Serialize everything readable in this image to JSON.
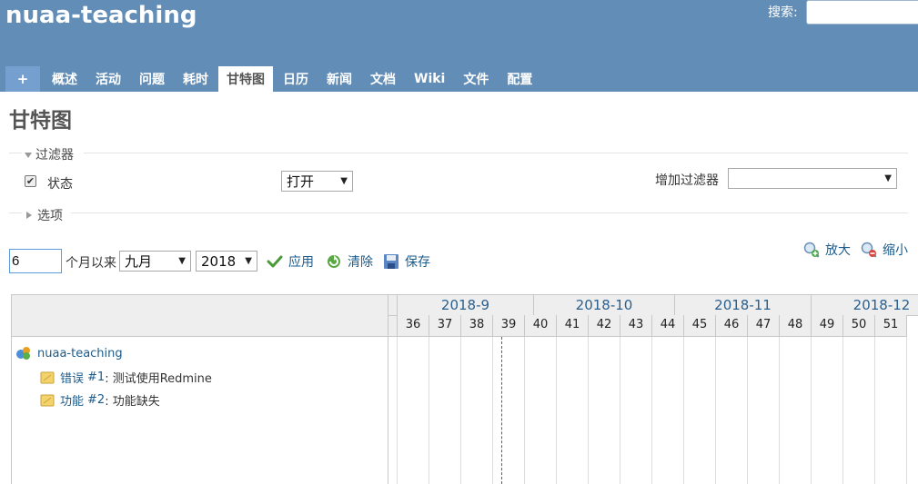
{
  "header": {
    "project_title": "nuaa-teaching",
    "search_label": "搜索:",
    "search_value": ""
  },
  "menu": {
    "new_label": "+",
    "items": [
      {
        "label": "概述",
        "name": "overview"
      },
      {
        "label": "活动",
        "name": "activity"
      },
      {
        "label": "问题",
        "name": "issues"
      },
      {
        "label": "耗时",
        "name": "spent-time"
      },
      {
        "label": "甘特图",
        "name": "gantt",
        "selected": true
      },
      {
        "label": "日历",
        "name": "calendar"
      },
      {
        "label": "新闻",
        "name": "news"
      },
      {
        "label": "文档",
        "name": "documents"
      },
      {
        "label": "Wiki",
        "name": "wiki"
      },
      {
        "label": "文件",
        "name": "files"
      },
      {
        "label": "配置",
        "name": "settings"
      }
    ]
  },
  "page": {
    "heading": "甘特图",
    "filters_legend": "过滤器",
    "status_label": "状态",
    "status_checked": true,
    "status_operator": "打开",
    "add_filter_label": "增加过滤器",
    "add_filter_value": "",
    "options_legend": "选项"
  },
  "controls": {
    "months_value": "6",
    "months_suffix": "个月以来",
    "month_select": "九月",
    "year_select": "2018",
    "apply_label": "应用",
    "clear_label": "清除",
    "save_label": "保存",
    "zoom_in_label": "放大",
    "zoom_out_label": "缩小"
  },
  "gantt": {
    "months": [
      "2018-9",
      "2018-10",
      "2018-11",
      "2018-12"
    ],
    "weeks": [
      "36",
      "37",
      "38",
      "39",
      "40",
      "41",
      "42",
      "43",
      "44",
      "45",
      "46",
      "47",
      "48",
      "49",
      "50",
      "51"
    ],
    "project": "nuaa-teaching",
    "issues": [
      {
        "tracker": "错误",
        "number": "#1",
        "subject": ": 测试使用Redmine"
      },
      {
        "tracker": "功能",
        "number": "#2",
        "subject": ": 功能缺失"
      }
    ]
  },
  "colors": {
    "header_bg": "#628db6",
    "link": "#1c5b8a",
    "today_line": "#c0304a"
  }
}
